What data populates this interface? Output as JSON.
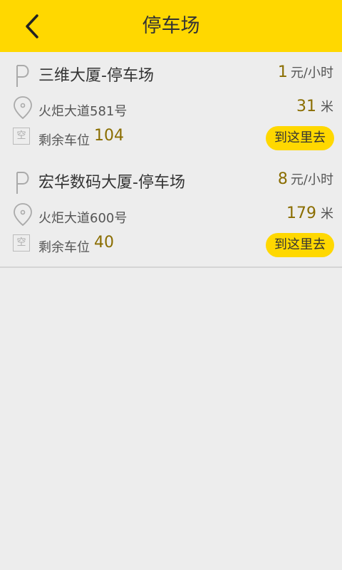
{
  "header": {
    "title": "停车场",
    "back_icon": "chevron-left-icon",
    "background": "#ffd800"
  },
  "lots": [
    {
      "name": "三维大厦-停车场",
      "price": "1",
      "price_unit": "元/小时",
      "address": "火炬大道581号",
      "distance": "31",
      "distance_unit": "米",
      "spaces_label": "剩余车位",
      "spaces": "104",
      "go_label": "到这里去"
    },
    {
      "name": "宏华数码大厦-停车场",
      "price": "8",
      "price_unit": "元/小时",
      "address": "火炬大道600号",
      "distance": "179",
      "distance_unit": "米",
      "spaces_label": "剩余车位",
      "spaces": "40",
      "go_label": "到这里去"
    }
  ],
  "icons": {
    "parking": "parking-icon",
    "location": "location-pin-icon",
    "empty_space": "empty-space-icon",
    "empty_space_glyph": "空"
  },
  "colors": {
    "accent": "#ffd800",
    "value_text": "#8a6d00"
  }
}
